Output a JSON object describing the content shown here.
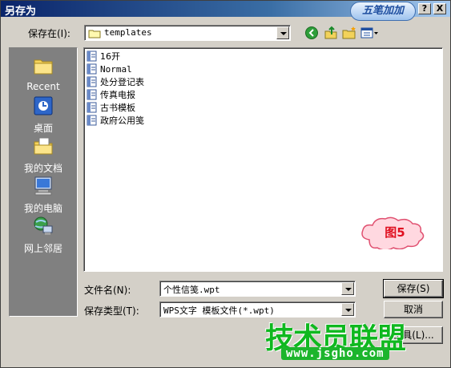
{
  "window": {
    "title": "另存为",
    "logo_text": "五笔加加",
    "help_button": "?",
    "close_button": "X"
  },
  "save_in": {
    "label": "保存在(I):",
    "value": "templates"
  },
  "places": [
    {
      "label": "Recent",
      "icon": "recent-folder-icon"
    },
    {
      "label": "桌面",
      "icon": "desktop-icon"
    },
    {
      "label": "我的文档",
      "icon": "my-documents-icon"
    },
    {
      "label": "我的电脑",
      "icon": "my-computer-icon"
    },
    {
      "label": "网上邻居",
      "icon": "network-icon"
    }
  ],
  "files": [
    {
      "name": "16开"
    },
    {
      "name": "Normal"
    },
    {
      "name": "处分登记表"
    },
    {
      "name": "传真电报"
    },
    {
      "name": "古书模板"
    },
    {
      "name": "政府公用笺"
    }
  ],
  "filename": {
    "label": "文件名(N):",
    "value": "个性信笺.wpt"
  },
  "filetype": {
    "label": "保存类型(T):",
    "value": "WPS文字 模板文件(*.wpt)"
  },
  "buttons": {
    "save": "保存(S)",
    "cancel": "取消",
    "tools": "工具(L)..."
  },
  "annotation": {
    "callout": "图5",
    "watermark_text": "技术员联盟",
    "watermark_url": "www.jsgho.com"
  },
  "colors": {
    "title_active": "#0a246a",
    "dialog_face": "#d4d0c8",
    "places_bar": "#808080",
    "watermark_green": "#0fb81f",
    "callout_red": "#e01020"
  }
}
